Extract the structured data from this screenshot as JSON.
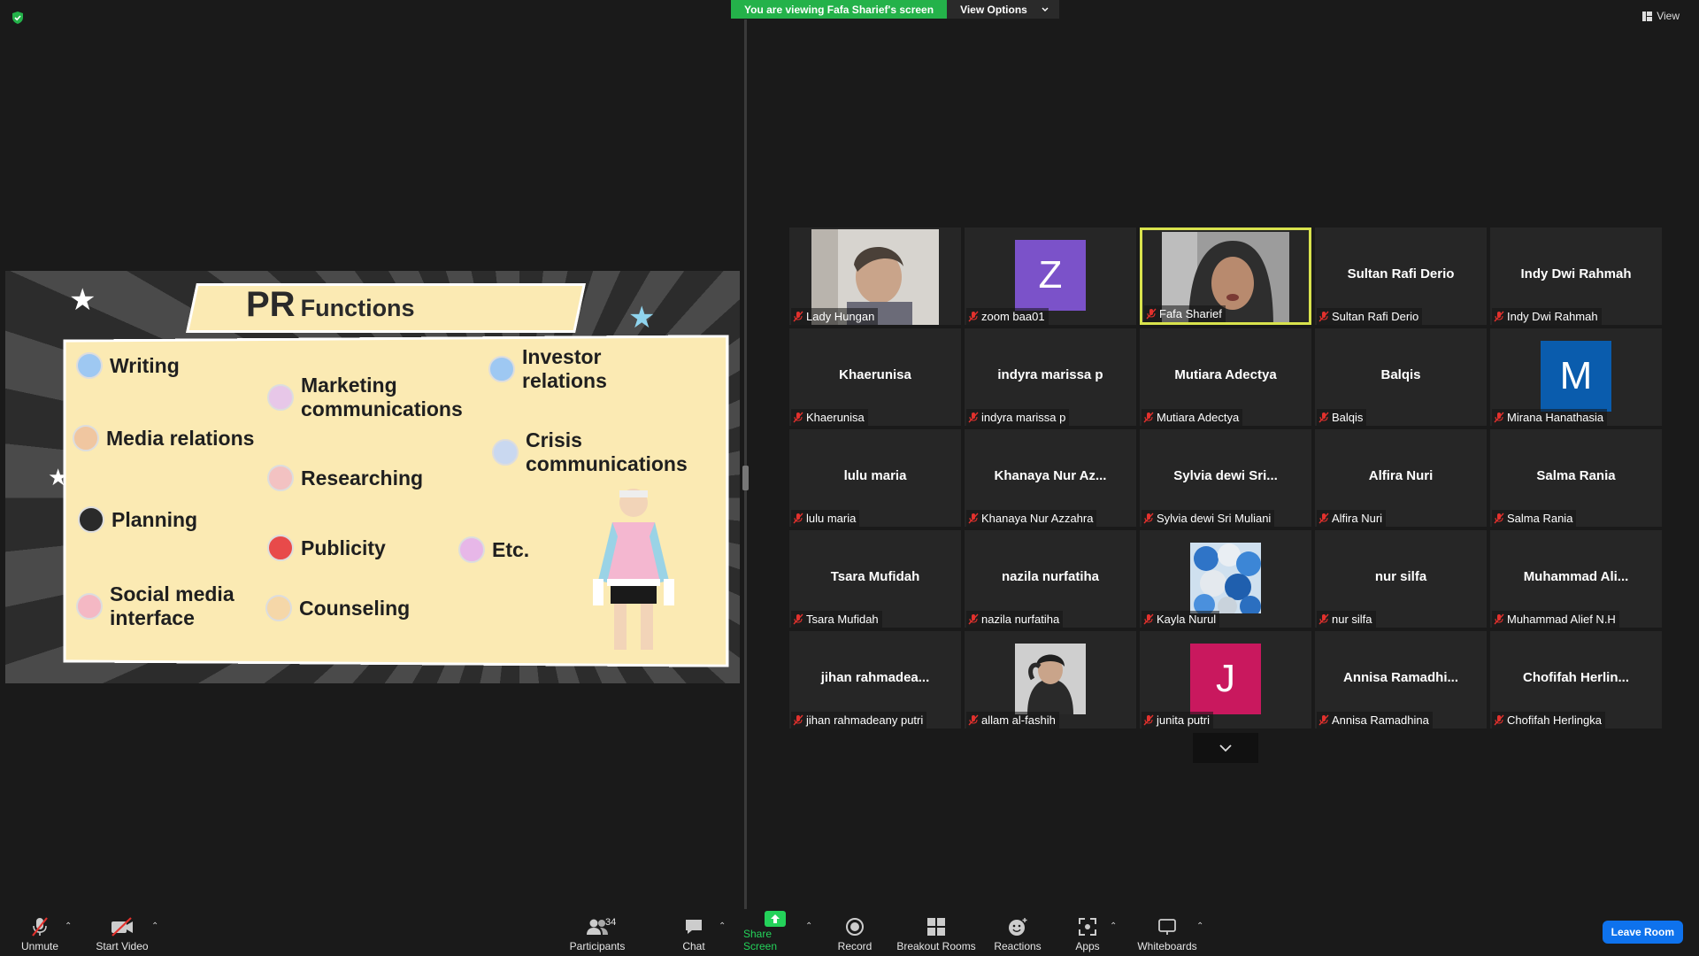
{
  "banner": {
    "viewing": "You are viewing Fafa Sharief's screen",
    "view_options": "View Options"
  },
  "view_button": "View",
  "slide": {
    "title_big": "PR",
    "title_small": "Functions",
    "items": [
      {
        "label": "Writing",
        "color": "#9ec8f2"
      },
      {
        "label": "Media relations",
        "color": "#f0c6a0"
      },
      {
        "label": "Planning",
        "color": "#2a2a2a"
      },
      {
        "label": "Social media\ninterface",
        "color": "#f4b8c4"
      },
      {
        "label": "Marketing\ncommunications",
        "color": "#e7c7e8"
      },
      {
        "label": "Researching",
        "color": "#f3c2c2"
      },
      {
        "label": "Publicity",
        "color": "#e84a4a"
      },
      {
        "label": "Counseling",
        "color": "#f5d7a8"
      },
      {
        "label": "Investor\nrelations",
        "color": "#9ec8f2"
      },
      {
        "label": "Crisis\ncommunications",
        "color": "#c9d8f0"
      },
      {
        "label": "Etc.",
        "color": "#e7b7e8"
      }
    ]
  },
  "participants": [
    {
      "display": "",
      "label": "Lady Hungan",
      "kind": "photo",
      "photo": "lady"
    },
    {
      "display": "Z",
      "label": "zoom baa01",
      "kind": "avatar",
      "color": "#7b52c9"
    },
    {
      "display": "",
      "label": "Fafa Sharief",
      "kind": "photo",
      "photo": "fafa",
      "active": true
    },
    {
      "display": "Sultan Rafi Derio",
      "label": "Sultan Rafi Derio",
      "kind": "name"
    },
    {
      "display": "Indy Dwi Rahmah",
      "label": "Indy Dwi Rahmah",
      "kind": "name"
    },
    {
      "display": "Khaerunisa",
      "label": "Khaerunisa",
      "kind": "name"
    },
    {
      "display": "indyra marissa p",
      "label": "indyra marissa p",
      "kind": "name"
    },
    {
      "display": "Mutiara Adectya",
      "label": "Mutiara Adectya",
      "kind": "name"
    },
    {
      "display": "Balqis",
      "label": "Balqis",
      "kind": "name"
    },
    {
      "display": "M",
      "label": "Mirana Hanathasia",
      "kind": "avatar",
      "color": "#0a5cad"
    },
    {
      "display": "lulu maria",
      "label": "lulu maria",
      "kind": "name"
    },
    {
      "display": "Khanaya Nur Az...",
      "label": "Khanaya Nur Azzahra",
      "kind": "name"
    },
    {
      "display": "Sylvia  dewi  Sri...",
      "label": "Sylvia dewi Sri Muliani",
      "kind": "name"
    },
    {
      "display": "Alfira Nuri",
      "label": "Alfira Nuri",
      "kind": "name"
    },
    {
      "display": "Salma Rania",
      "label": "Salma Rania",
      "kind": "name"
    },
    {
      "display": "Tsara Mufidah",
      "label": "Tsara Mufidah",
      "kind": "name"
    },
    {
      "display": "nazila nurfatiha",
      "label": "nazila nurfatiha",
      "kind": "name"
    },
    {
      "display": "",
      "label": "Kayla Nurul",
      "kind": "photo",
      "photo": "balloons"
    },
    {
      "display": "nur silfa",
      "label": "nur silfa",
      "kind": "name"
    },
    {
      "display": "Muhammad  Ali...",
      "label": "Muhammad Alief N.H",
      "kind": "name"
    },
    {
      "display": "jihan  rahmadea...",
      "label": "jihan rahmadeany putri",
      "kind": "name"
    },
    {
      "display": "",
      "label": "allam al-fashih",
      "kind": "photo",
      "photo": "allam"
    },
    {
      "display": "J",
      "label": "junita putri",
      "kind": "avatar",
      "color": "#c9185e"
    },
    {
      "display": "Annisa  Ramadhi...",
      "label": "Annisa Ramadhina",
      "kind": "name"
    },
    {
      "display": "Chofifah  Herlin...",
      "label": "Chofifah Herlingka",
      "kind": "name"
    }
  ],
  "toolbar": {
    "unmute": "Unmute",
    "start_video": "Start Video",
    "participants": "Participants",
    "participants_count": "34",
    "chat": "Chat",
    "share_screen": "Share Screen",
    "record": "Record",
    "breakout_rooms": "Breakout Rooms",
    "reactions": "Reactions",
    "apps": "Apps",
    "whiteboards": "Whiteboards",
    "leave": "Leave Room"
  }
}
